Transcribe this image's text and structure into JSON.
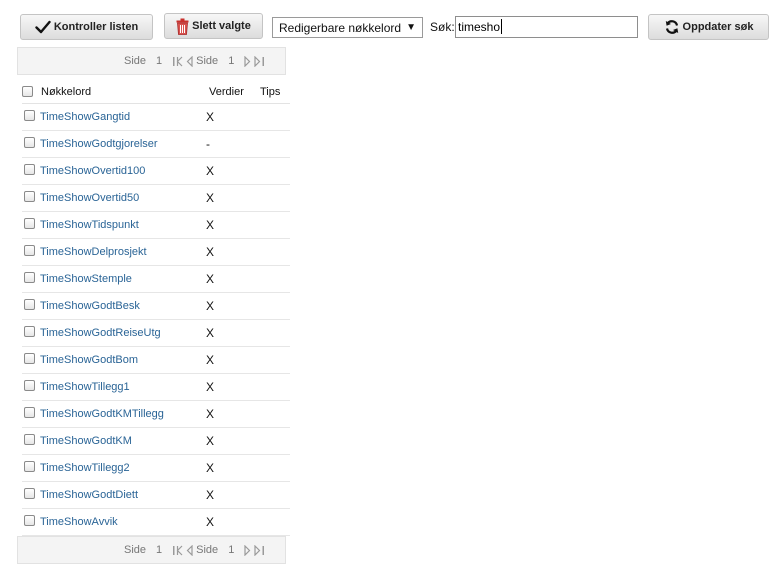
{
  "toolbar": {
    "check_list_label": "Kontroller listen",
    "delete_selected_label": "Slett valgte",
    "filter_select_value": "Redigerbare nøkkelord",
    "search_label": "Søk:",
    "search_value": "timesho",
    "update_search_label": "Oppdater søk"
  },
  "pager_top": {
    "page_label_1": "Side",
    "page_number_1": "1",
    "page_label_2": "Side",
    "page_number_2": "1"
  },
  "pager_bottom": {
    "page_label_1": "Side",
    "page_number_1": "1",
    "page_label_2": "Side",
    "page_number_2": "1"
  },
  "table": {
    "headers": {
      "keyword": "Nøkkelord",
      "values": "Verdier",
      "tips": "Tips"
    },
    "rows": [
      {
        "keyword": "TimeShowGangtid",
        "values": "X"
      },
      {
        "keyword": "TimeShowGodtgjorelser",
        "values": "-"
      },
      {
        "keyword": "TimeShowOvertid100",
        "values": "X"
      },
      {
        "keyword": "TimeShowOvertid50",
        "values": "X"
      },
      {
        "keyword": "TimeShowTidspunkt",
        "values": "X"
      },
      {
        "keyword": "TimeShowDelprosjekt",
        "values": "X"
      },
      {
        "keyword": "TimeShowStemple",
        "values": "X"
      },
      {
        "keyword": "TimeShowGodtBesk",
        "values": "X"
      },
      {
        "keyword": "TimeShowGodtReiseUtg",
        "values": "X"
      },
      {
        "keyword": "TimeShowGodtBom",
        "values": "X"
      },
      {
        "keyword": "TimeShowTillegg1",
        "values": "X"
      },
      {
        "keyword": "TimeShowGodtKMTillegg",
        "values": "X"
      },
      {
        "keyword": "TimeShowGodtKM",
        "values": "X"
      },
      {
        "keyword": "TimeShowTillegg2",
        "values": "X"
      },
      {
        "keyword": "TimeShowGodtDiett",
        "values": "X"
      },
      {
        "keyword": "TimeShowAvvik",
        "values": "X"
      }
    ]
  },
  "colors": {
    "link": "#2a6496",
    "delete_icon": "#c9302c",
    "pager_background": "#f4f4f4"
  },
  "icons": {
    "check": "checkmark-icon",
    "delete": "trash-icon",
    "refresh": "refresh-icon",
    "first_page": "first-page-icon",
    "prev_page": "prev-page-icon",
    "next_page": "next-page-icon",
    "last_page": "last-page-icon"
  }
}
